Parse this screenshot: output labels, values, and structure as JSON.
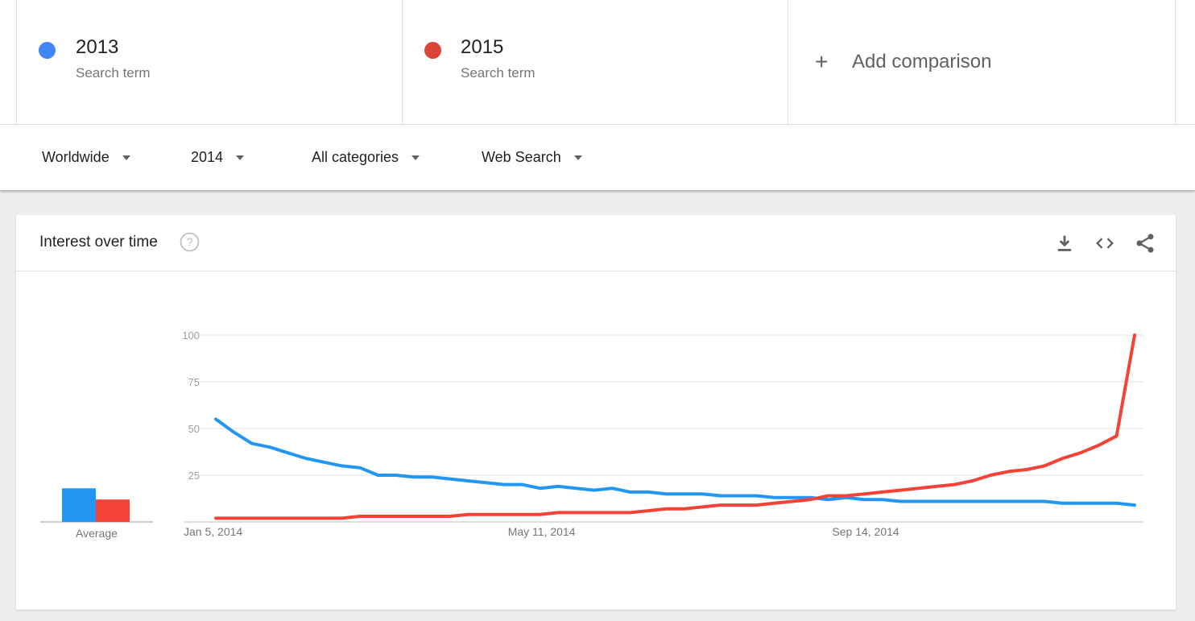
{
  "compare": {
    "terms": [
      {
        "name": "2013",
        "sub": "Search term",
        "color": "#4285f4"
      },
      {
        "name": "2015",
        "sub": "Search term",
        "color": "#db4437"
      }
    ],
    "add_label": "Add comparison",
    "add_icon": "plus-icon"
  },
  "filters": {
    "region": "Worldwide",
    "period": "2014",
    "category": "All categories",
    "search_type": "Web Search",
    "dropdown_icon": "caret-down-icon"
  },
  "card": {
    "title": "Interest over time",
    "help_icon": "help-circle-icon",
    "actions": [
      "download-icon",
      "embed-code-icon",
      "share-icon"
    ]
  },
  "chart_data": {
    "type": "line",
    "title": "Interest over time",
    "xlabel": "",
    "ylabel": "",
    "ylim": [
      0,
      100
    ],
    "yticks": [
      "100",
      "75",
      "50",
      "25"
    ],
    "xticks": [
      "Jan 5, 2014",
      "May 11, 2014",
      "Sep 14, 2014"
    ],
    "xtick_index": [
      0,
      18,
      36
    ],
    "x_count": 52,
    "grid": true,
    "legend": "top",
    "average_label": "Average",
    "averages": [
      18,
      12
    ],
    "series": [
      {
        "name": "2013",
        "color": "#2196f3",
        "values": [
          55,
          48,
          42,
          40,
          37,
          34,
          32,
          30,
          29,
          25,
          25,
          24,
          24,
          23,
          22,
          21,
          20,
          20,
          18,
          19,
          18,
          17,
          18,
          16,
          16,
          15,
          15,
          15,
          14,
          14,
          14,
          13,
          13,
          13,
          12,
          13,
          12,
          12,
          11,
          11,
          11,
          11,
          11,
          11,
          11,
          11,
          11,
          10,
          10,
          10,
          10,
          9
        ]
      },
      {
        "name": "2015",
        "color": "#f44336",
        "values": [
          2,
          2,
          2,
          2,
          2,
          2,
          2,
          2,
          3,
          3,
          3,
          3,
          3,
          3,
          4,
          4,
          4,
          4,
          4,
          5,
          5,
          5,
          5,
          5,
          6,
          7,
          7,
          8,
          9,
          9,
          9,
          10,
          11,
          12,
          14,
          14,
          15,
          16,
          17,
          18,
          19,
          20,
          22,
          25,
          27,
          28,
          30,
          34,
          37,
          41,
          46,
          100
        ]
      }
    ]
  }
}
